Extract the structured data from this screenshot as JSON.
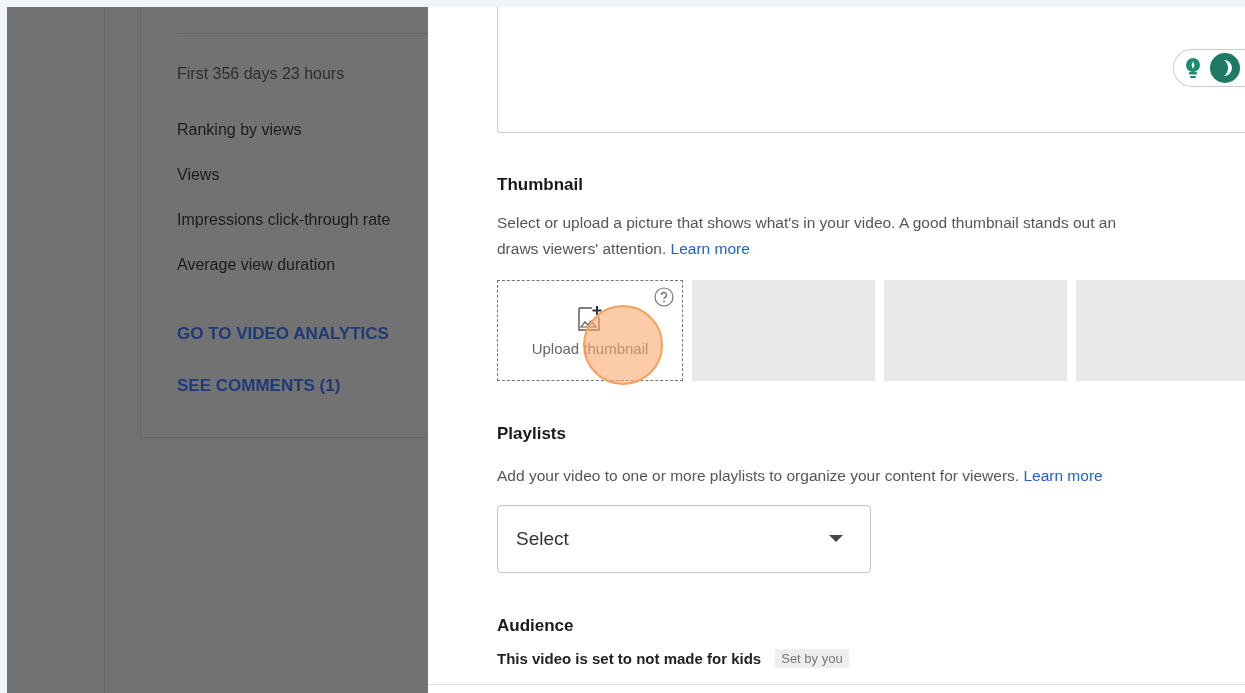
{
  "analytics_card": {
    "period": "First 356 days 23 hours",
    "metrics": [
      "Ranking by views",
      "Views",
      "Impressions click-through rate",
      "Average view duration"
    ],
    "links": [
      "GO TO VIDEO ANALYTICS",
      "SEE COMMENTS (1)"
    ]
  },
  "thumbnail": {
    "title": "Thumbnail",
    "description_lines": [
      "Select or upload a picture that shows what's in your video. A good thumbnail stands out an",
      "draws viewers' attention."
    ],
    "learn_more": "Learn more",
    "upload_label": "Upload thumbnail",
    "slots": [
      {
        "kind": "empty"
      },
      {
        "kind": "empty"
      },
      {
        "kind": "empty"
      }
    ]
  },
  "playlists": {
    "title": "Playlists",
    "description": "Add your video to one or more playlists to organize your content for viewers.",
    "learn_more": "Learn more",
    "select": {
      "value": "Select"
    }
  },
  "audience": {
    "title": "Audience",
    "status": "This video is set to not made for kids",
    "badge": "Set by you"
  }
}
